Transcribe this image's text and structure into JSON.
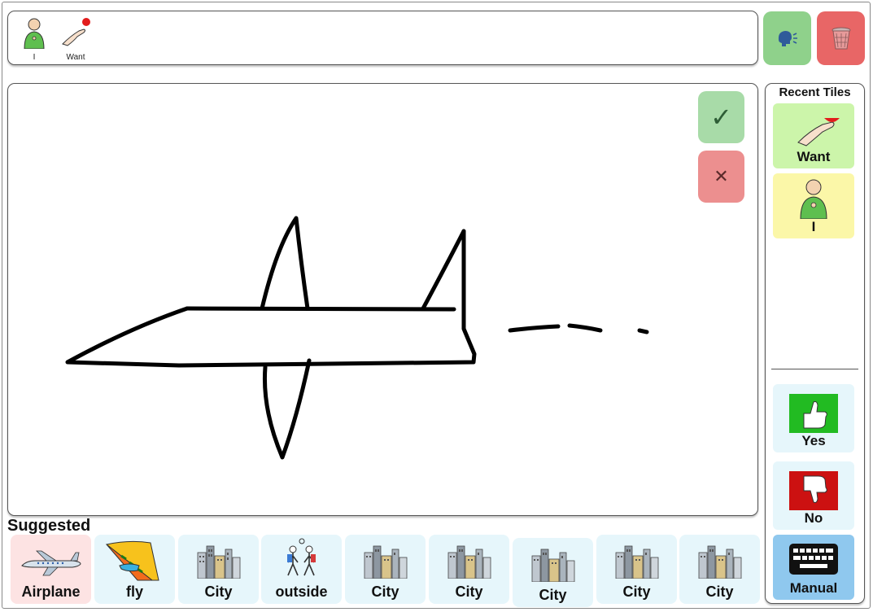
{
  "sentence": {
    "tiles": [
      {
        "label": "I",
        "icon": "person-self-icon"
      },
      {
        "label": "Want",
        "icon": "hand-want-icon"
      }
    ]
  },
  "actions": {
    "speak_icon": "speak-icon",
    "clear_icon": "trash-icon"
  },
  "canvas": {
    "confirm_symbol": "✓",
    "cancel_symbol": "✕"
  },
  "recent": {
    "title": "Recent Tiles",
    "tiles": [
      {
        "label": "Want",
        "icon": "hand-want-icon",
        "color": "#ccf5aa"
      },
      {
        "label": "I",
        "icon": "person-self-icon",
        "color": "#fbf7a8"
      }
    ],
    "yes_label": "Yes",
    "no_label": "No",
    "manual_label": "Manual"
  },
  "suggested": {
    "title": "Suggested",
    "tiles": [
      {
        "label": "Airplane",
        "icon": "airplane-icon"
      },
      {
        "label": "fly",
        "icon": "hang-glider-icon"
      },
      {
        "label": "City",
        "icon": "city-icon"
      },
      {
        "label": "outside",
        "icon": "walking-people-icon"
      },
      {
        "label": "City",
        "icon": "city-icon"
      },
      {
        "label": "City",
        "icon": "city-icon"
      },
      {
        "label": "City",
        "icon": "city-icon"
      },
      {
        "label": "City",
        "icon": "city-icon"
      },
      {
        "label": "City",
        "icon": "city-icon"
      }
    ]
  },
  "colors": {
    "speak": "#8fd18b",
    "clear": "#e86666",
    "confirm": "#a8dba8",
    "cancel": "#ec8f8f",
    "suggested_bg": "#e6f6fb",
    "airplane_bg": "#fde3e3",
    "manual_bg": "#8fc8ee",
    "yes_green": "#22bb22",
    "no_red": "#cc1111"
  }
}
